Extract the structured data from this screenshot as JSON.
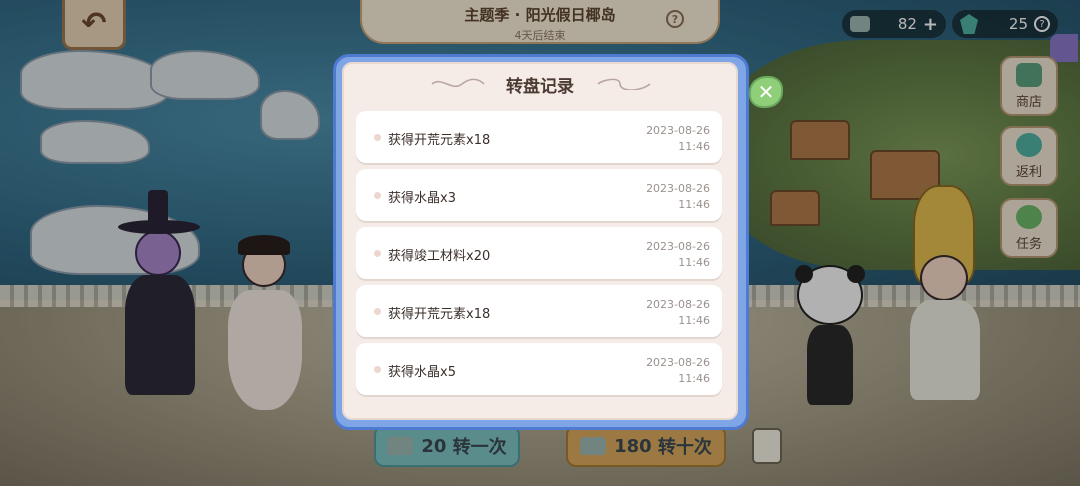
{
  "hud": {
    "back_icon": "back-arrow-icon",
    "season_title": "主题季 · 阳光假日椰岛",
    "season_subtitle": "4天后结束",
    "help_glyph": "?",
    "coins": "82",
    "coins_plus": "+",
    "gems": "25",
    "gems_help": "?"
  },
  "side_menu": [
    {
      "label": "商店",
      "icon": "shop-icon",
      "color": "#5aa07f"
    },
    {
      "label": "返利",
      "icon": "gem-icon",
      "color": "#4fb0a0"
    },
    {
      "label": "任务",
      "icon": "clover-icon",
      "color": "#6cb86a"
    }
  ],
  "spin_buttons": [
    {
      "cost": "20",
      "label": "转一次",
      "color": "#7fc2c3"
    },
    {
      "cost": "180",
      "label": "转十次",
      "color": "#d8a85d"
    }
  ],
  "modal": {
    "title": "转盘记录",
    "close_glyph": "✕",
    "records": [
      {
        "text": "获得开荒元素x18",
        "date": "2023-08-26",
        "time": "11:46"
      },
      {
        "text": "获得水晶x3",
        "date": "2023-08-26",
        "time": "11:46"
      },
      {
        "text": "获得竣工材料x20",
        "date": "2023-08-26",
        "time": "11:46"
      },
      {
        "text": "获得开荒元素x18",
        "date": "2023-08-26",
        "time": "11:46"
      },
      {
        "text": "获得水晶x5",
        "date": "2023-08-26",
        "time": "11:46"
      }
    ]
  },
  "colors": {
    "modal_frame": "#7ea5e6",
    "modal_bg": "#f5ece8",
    "close_button": "#8fcf7a"
  }
}
